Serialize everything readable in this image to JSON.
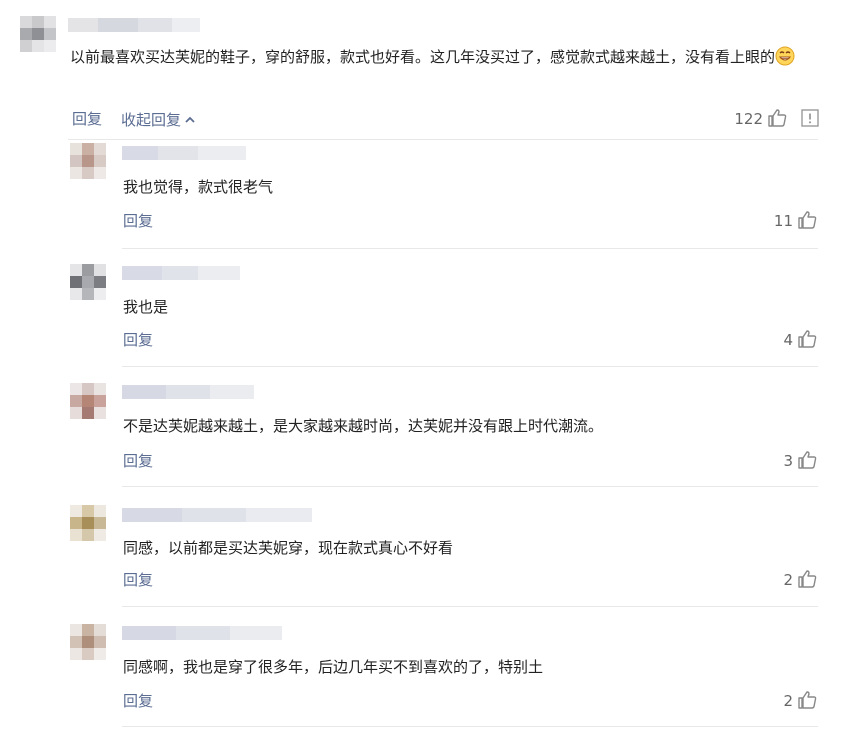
{
  "main_comment": {
    "text": "以前最喜欢买达芙妮的鞋子，穿的舒服，款式也好看。这几年没买过了，感觉款式越来越土，没有看上眼的",
    "emoji": "grin-emoji",
    "reply_label": "回复",
    "collapse_label": "收起回复",
    "likes": "122"
  },
  "replies": [
    {
      "text": "我也觉得，款式很老气",
      "reply_label": "回复",
      "likes": "11"
    },
    {
      "text": "我也是",
      "reply_label": "回复",
      "likes": "4"
    },
    {
      "text": "不是达芙妮越来越土，是大家越来越时尚，达芙妮并没有跟上时代潮流。",
      "reply_label": "回复",
      "likes": "3"
    },
    {
      "text": "同感，以前都是买达芙妮穿，现在款式真心不好看",
      "reply_label": "回复",
      "likes": "2"
    },
    {
      "text": "同感啊，我也是穿了很多年，后边几年买不到喜欢的了，特别土",
      "reply_label": "回复",
      "likes": "2"
    }
  ],
  "colors": {
    "link": "#5b6d93",
    "text": "#222222",
    "divider": "#e8e8e8"
  }
}
